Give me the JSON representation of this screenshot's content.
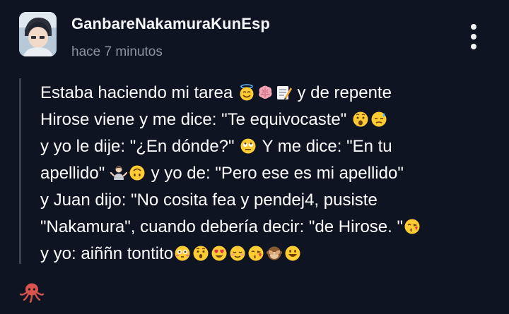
{
  "header": {
    "username": "GanbareNakamuraKunEsp",
    "timestamp": "hace 7 minutos",
    "avatar_icon": "profile-avatar",
    "more_icon": "vertical-ellipsis-icon"
  },
  "post": {
    "lines": [
      {
        "parts": [
          "Estaba haciendo mi tarea ",
          "",
          "",
          "",
          "  y de repente"
        ],
        "emoji": [
          "halo",
          "brain",
          "memo"
        ]
      },
      {
        "text": "Hirose viene y me dice: \"Te equivocaste\" "
      },
      {
        "text": "y yo le dije: \"¿En dónde?\" "
      },
      {
        "text": "apellido\" "
      },
      {
        "text": "y Juan dijo: \"No cosita fea y pendej4, pusiste"
      },
      {
        "text": "\"Nakamura\", cuando debería decir: \"de Hirose. \""
      },
      {
        "text": "y yo: aiññn tontito"
      }
    ],
    "line1_a": "Estaba haciendo mi tarea",
    "line1_b": "y de repente",
    "line2_a": "Hirose viene y me dice: \"Te equivocaste\"",
    "line3_a": "y yo le dije: \"¿En dónde?\"",
    "line3_b": "Y me dice: \"En tu",
    "line4_a": "apellido\"",
    "line4_b": "y yo de: \"Pero ese es mi apellido\"",
    "line5_a": "y Juan dijo: \"No cosita fea y pendej4, pusiste",
    "line6_a": "\"Nakamura\", cuando debería decir: \"de Hirose. \"",
    "line7_a": "y yo: aiññn tontito"
  },
  "footer": {
    "icon": "octopus-icon"
  },
  "colors": {
    "background": "#0f1422",
    "text": "#ffffff",
    "muted": "#8e949f",
    "quote_bar": "#3b4150"
  }
}
